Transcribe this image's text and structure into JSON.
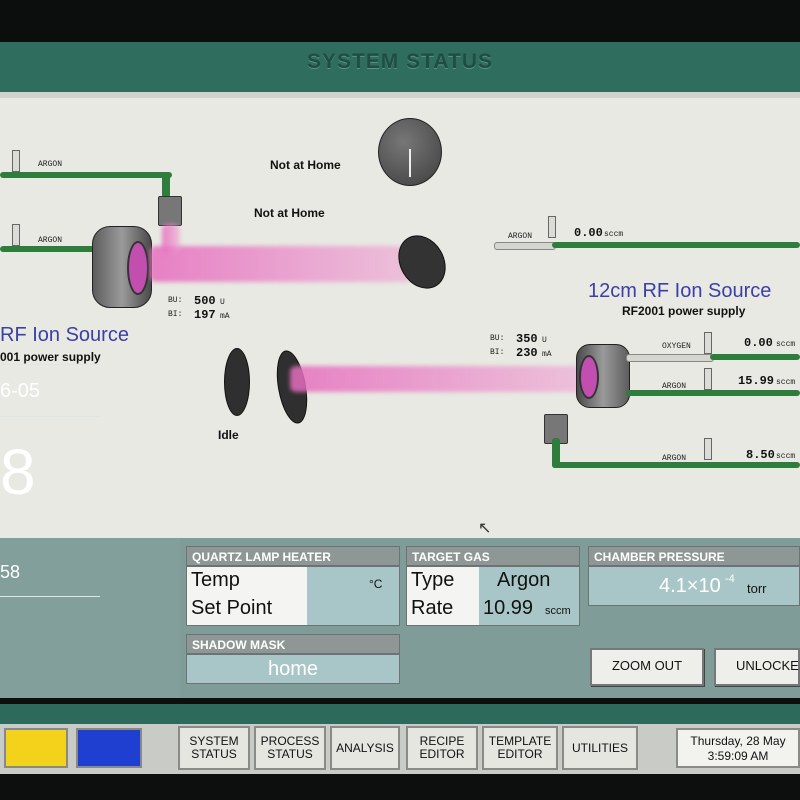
{
  "window": {
    "title": "SYSTEM STATUS"
  },
  "diagram": {
    "upper_status": "Not at Home",
    "lower_status": "Not at Home",
    "idle_status": "Idle",
    "pipe_argon_1": "ARGON",
    "pipe_argon_2": "ARGON",
    "right_argon_label": "ARGON",
    "right_argon_value": "0.00",
    "right_argon_unit": "sccm",
    "left_source": {
      "bu_label": "BU:",
      "bu_value": "500",
      "bu_unit": "U",
      "bi_label": "BI:",
      "bi_value": "197",
      "bi_unit": "mA",
      "title_partial": "RF Ion Source",
      "subtitle_partial": "001 power supply"
    },
    "right_source": {
      "title": "12cm RF Ion Source",
      "subtitle": "RF2001 power supply",
      "bu_label": "BU:",
      "bu_value": "350",
      "bu_unit": "U",
      "bi_label": "BI:",
      "bi_value": "230",
      "bi_unit": "mA",
      "gas_lines": [
        {
          "label": "OXYGEN",
          "value": "0.00",
          "unit": "sccm"
        },
        {
          "label": "ARGON",
          "value": "15.99",
          "unit": "sccm"
        },
        {
          "label": "ARGON",
          "value": "8.50",
          "unit": "sccm"
        }
      ]
    }
  },
  "left_panel": {
    "line1": "6-05",
    "big_value": "8",
    "line2": "58"
  },
  "quartz_lamp_heater": {
    "header": "QUARTZ LAMP HEATER",
    "temp_label": "Temp",
    "setpoint_label": "Set Point",
    "unit": "°C"
  },
  "target_gas": {
    "header": "TARGET GAS",
    "type_label": "Type",
    "type_value": "Argon",
    "rate_label": "Rate",
    "rate_value": "10.99",
    "rate_unit": "sccm"
  },
  "chamber_pressure": {
    "header": "CHAMBER PRESSURE",
    "value": "4.1×10",
    "exponent": "-4",
    "unit": "torr"
  },
  "shadow_mask": {
    "header": "SHADOW MASK",
    "value": "home"
  },
  "buttons": {
    "zoom_out": "ZOOM OUT",
    "unlocked": "UNLOCKED"
  },
  "taskbar": {
    "system_status": "SYSTEM STATUS",
    "process_status": "PROCESS STATUS",
    "analysis": "ANALYSIS",
    "recipe_editor": "RECIPE EDITOR",
    "template_editor": "TEMPLATE EDITOR",
    "utilities": "UTILITIES",
    "date": "Thursday, 28 May",
    "time": "3:59:09 AM",
    "yellow_indicator": "#f2d21b",
    "blue_indicator": "#1f3fd0"
  },
  "colors": {
    "pipe": "#2e7d3d",
    "title_bar": "#2f6d5f",
    "panel_bg": "#7f9c98",
    "beam": "#e66ebe"
  }
}
